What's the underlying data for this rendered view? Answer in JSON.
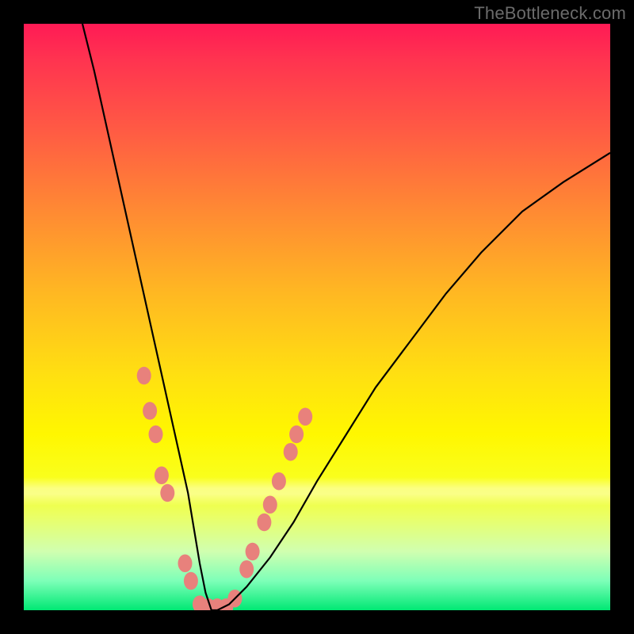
{
  "watermark": {
    "text": "TheBottleneck.com"
  },
  "chart_data": {
    "type": "line",
    "title": "",
    "xlabel": "",
    "ylabel": "",
    "xlim": [
      0,
      100
    ],
    "ylim": [
      0,
      100
    ],
    "grid": false,
    "legend": false,
    "background_gradient": {
      "direction": "top-to-bottom",
      "stops": [
        {
          "pos": 0.0,
          "color": "#ff1a55"
        },
        {
          "pos": 0.18,
          "color": "#ff5a44"
        },
        {
          "pos": 0.46,
          "color": "#ffb822"
        },
        {
          "pos": 0.7,
          "color": "#fff700"
        },
        {
          "pos": 0.9,
          "color": "#d0ffb0"
        },
        {
          "pos": 1.0,
          "color": "#00e874"
        }
      ]
    },
    "series": [
      {
        "name": "bottleneck-curve",
        "color": "#000000",
        "x": [
          10,
          12,
          14,
          16,
          18,
          20,
          22,
          24,
          26,
          28,
          29,
          30,
          31,
          32,
          33,
          35,
          38,
          42,
          46,
          50,
          55,
          60,
          66,
          72,
          78,
          85,
          92,
          100
        ],
        "y": [
          100,
          92,
          83,
          74,
          65,
          56,
          47,
          38,
          29,
          20,
          14,
          8,
          3,
          0,
          0,
          1,
          4,
          9,
          15,
          22,
          30,
          38,
          46,
          54,
          61,
          68,
          73,
          78
        ]
      }
    ],
    "markers": [
      {
        "name": "highlight-dots",
        "color": "#e8817c",
        "radius": 9,
        "points": [
          {
            "x": 20.5,
            "y": 40
          },
          {
            "x": 21.5,
            "y": 34
          },
          {
            "x": 22.5,
            "y": 30
          },
          {
            "x": 23.5,
            "y": 23
          },
          {
            "x": 24.5,
            "y": 20
          },
          {
            "x": 27.5,
            "y": 8
          },
          {
            "x": 28.5,
            "y": 5
          },
          {
            "x": 30.0,
            "y": 1
          },
          {
            "x": 31.5,
            "y": 0.5
          },
          {
            "x": 33.0,
            "y": 0.5
          },
          {
            "x": 34.5,
            "y": 0.5
          },
          {
            "x": 36.0,
            "y": 2
          },
          {
            "x": 38.0,
            "y": 7
          },
          {
            "x": 39.0,
            "y": 10
          },
          {
            "x": 41.0,
            "y": 15
          },
          {
            "x": 42.0,
            "y": 18
          },
          {
            "x": 43.5,
            "y": 22
          },
          {
            "x": 45.5,
            "y": 27
          },
          {
            "x": 46.5,
            "y": 30
          },
          {
            "x": 48.0,
            "y": 33
          }
        ]
      }
    ]
  }
}
